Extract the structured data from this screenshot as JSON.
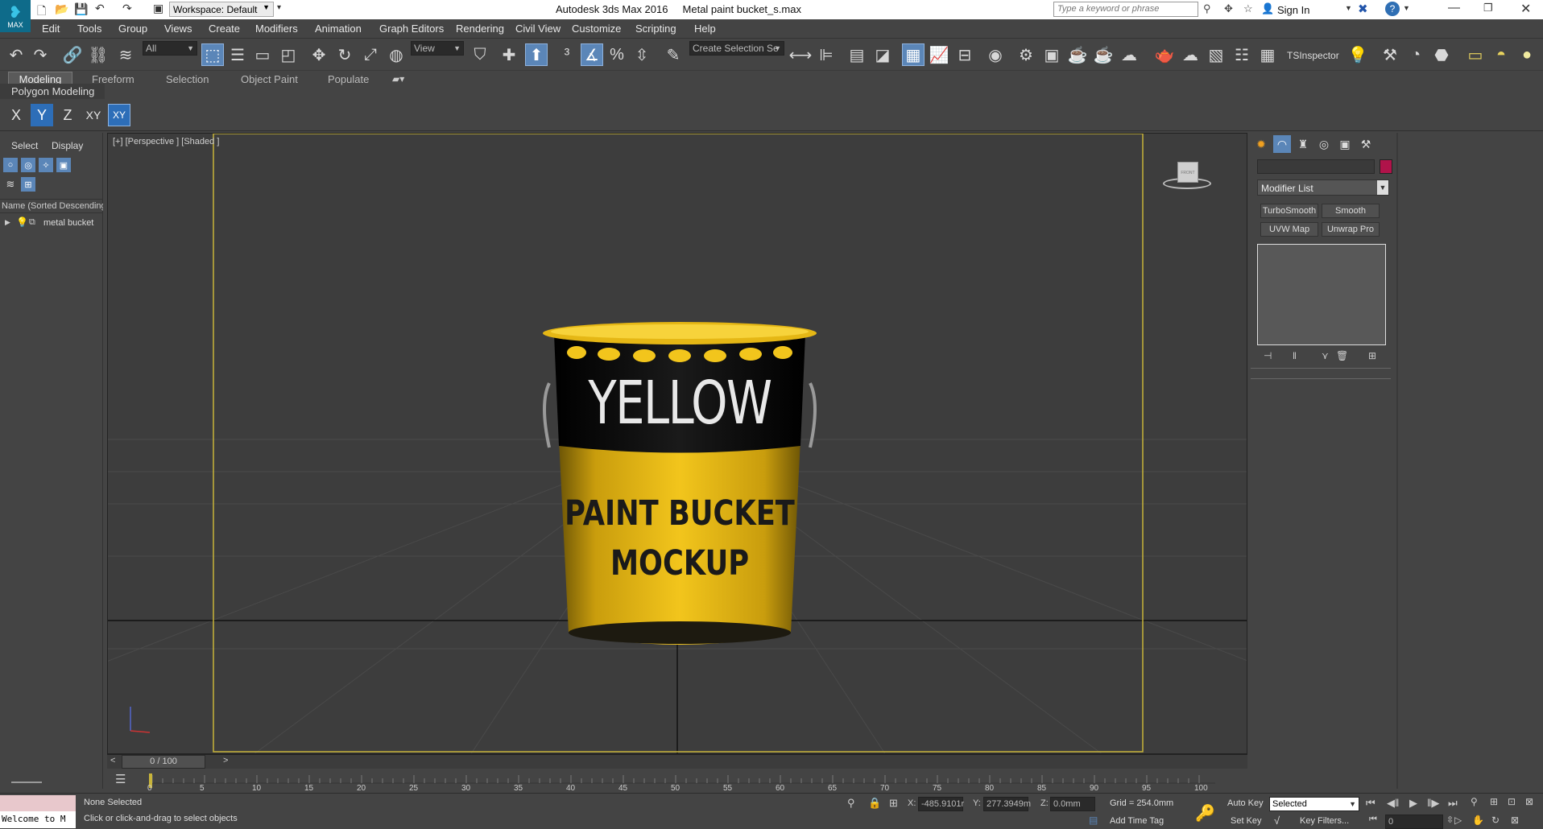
{
  "window": {
    "title": "Autodesk 3ds Max 2016     Metal paint bucket_s.max",
    "workspace": "Workspace: Default",
    "search_placeholder": "Type a keyword or phrase",
    "sign_in": "Sign In",
    "app_logo": "MAX"
  },
  "menu": [
    "Edit",
    "Tools",
    "Group",
    "Views",
    "Create",
    "Modifiers",
    "Animation",
    "Graph Editors",
    "Rendering",
    "Civil View",
    "Customize",
    "Scripting",
    "Help"
  ],
  "toolbar": {
    "selection_filter": "All",
    "reference_coord": "View",
    "named_selection": "Create Selection Se",
    "tsinspector": "TSInspector"
  },
  "ribbon": {
    "tabs": [
      "Modeling",
      "Freeform",
      "Selection",
      "Object Paint",
      "Populate"
    ],
    "active": "Modeling",
    "sub": "Polygon Modeling"
  },
  "axis_constraints": [
    "X",
    "Y",
    "Z",
    "XY",
    "XY"
  ],
  "scene_explorer": {
    "tabs": [
      "Select",
      "Display"
    ],
    "column": "Name (Sorted Descending",
    "items": [
      {
        "name": "metal bucket"
      }
    ]
  },
  "viewport": {
    "label": "[+] [Perspective ] [Shaded ]",
    "viewcube": "FRONT",
    "bucket_brand": "YELLOW",
    "bucket_line1": "PAINT BUCKET",
    "bucket_line2": "MOCKUP",
    "colors": {
      "bucket_yellow": "#f2c51c",
      "band_black": "#111111",
      "safe_frame": "#c8b43a"
    }
  },
  "command_panel": {
    "modifier_list": "Modifier List",
    "buttons": [
      "TurboSmooth",
      "Smooth",
      "UVW Map",
      "Unwrap Pro"
    ],
    "object_color": "#b0134a"
  },
  "timeline": {
    "frame": "0 / 100",
    "ticks": [
      "0",
      "5",
      "10",
      "15",
      "20",
      "25",
      "30",
      "35",
      "40",
      "45",
      "50",
      "55",
      "60",
      "65",
      "70",
      "75",
      "80",
      "85",
      "90",
      "95",
      "100"
    ]
  },
  "status": {
    "listener": "Welcome to M",
    "selection": "None Selected",
    "prompt": "Click or click-and-drag to select objects",
    "x_label": "X:",
    "x_value": "-485.9101r",
    "y_label": "Y:",
    "y_value": "277.3949m",
    "z_label": "Z:",
    "z_value": "0.0mm",
    "grid": "Grid = 254.0mm",
    "add_time_tag": "Add Time Tag",
    "auto_key": "Auto Key",
    "set_key": "Set Key",
    "key_mode": "Selected",
    "key_filters": "Key Filters...",
    "current_frame": "0"
  }
}
